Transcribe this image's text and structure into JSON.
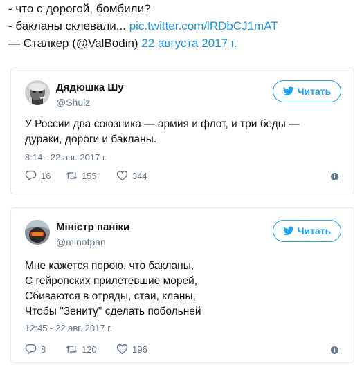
{
  "quote": {
    "line1": "- что с дорогой, бомбили?",
    "line2_text": "- бакланы склевали... ",
    "line2_link": "pic.twitter.com/lRDbCJ1mAT",
    "line3_text": "— Сталкер (@ValBodin) ",
    "line3_date": "22 августа 2017 г."
  },
  "tweets": [
    {
      "name": "Дядюшка Шу",
      "handle": "@Shulz",
      "follow_label": "Читать",
      "lines": [
        "У России два союзника — армия и флот, и три беды —",
        "дураки, дороги и бакланы."
      ],
      "time": "8:14 - 22 авг. 2017 г.",
      "replies": "16",
      "retweets": "155",
      "likes": "344",
      "info": "i"
    },
    {
      "name": "Міністр паніки",
      "handle": "@minofpan",
      "follow_label": "Читать",
      "lines": [
        "Мне кажется порою. что бакланы,",
        "С гейропских прилетевшие морей,",
        "Сбиваются в отряды, стаи, кланы,",
        "Чтобы \"Зениту\" сделать побольней"
      ],
      "time": "12:45 - 22 авг. 2017 г.",
      "replies": "8",
      "retweets": "120",
      "likes": "196",
      "info": "i"
    }
  ],
  "colors": {
    "accent": "#1da1f2",
    "link": "#1b95e0",
    "muted": "#657786",
    "border": "#e1e8ed"
  },
  "icons": [
    "twitter-bird-icon",
    "reply-icon",
    "retweet-icon",
    "heart-icon",
    "info-icon"
  ]
}
